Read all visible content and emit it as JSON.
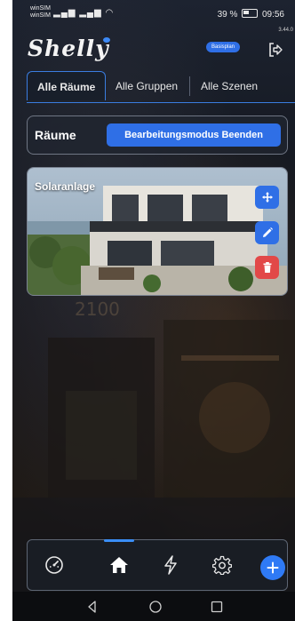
{
  "status_bar": {
    "sim1": "winSIM",
    "sim2": "winSIM",
    "battery": "39 %",
    "time": "09:56"
  },
  "header": {
    "logo": "Shelly",
    "version": "3.44.0",
    "plan_badge": "Basisplan",
    "logout_icon": "logout-icon"
  },
  "tabs": [
    {
      "label": "Alle Räume",
      "active": true
    },
    {
      "label": "Alle Gruppen",
      "active": false
    },
    {
      "label": "Alle Szenen",
      "active": false
    }
  ],
  "rooms_bar": {
    "title": "Räume",
    "edit_button": "Bearbeitungsmodus Beenden"
  },
  "rooms": [
    {
      "name": "Solaranlage",
      "actions": [
        "move-icon",
        "edit-icon",
        "delete-icon"
      ]
    }
  ],
  "bottom_nav": {
    "items": [
      "dashboard-icon",
      "home-icon",
      "energy-icon",
      "settings-icon",
      "add-icon"
    ],
    "active": "home-icon"
  },
  "system_nav": [
    "back-icon",
    "home-circle-icon",
    "recents-icon"
  ],
  "colors": {
    "accent": "#2f6fe6",
    "danger": "#e24848",
    "background": "#141820"
  }
}
